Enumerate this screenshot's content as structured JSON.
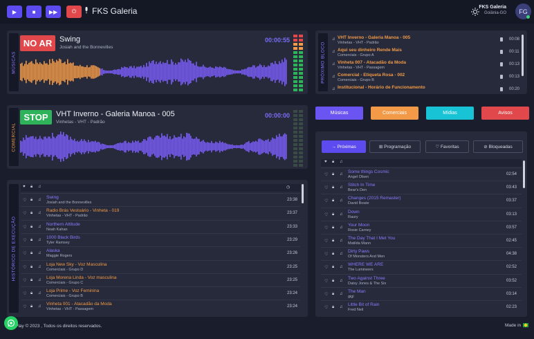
{
  "header": {
    "title": "FKS Galeria",
    "user_name": "FKS Galeria",
    "user_city": "Goiânia-GO",
    "avatar_initials": "FG",
    "buttons": [
      "play-icon",
      "stop-icon",
      "skip-icon",
      "power-icon"
    ]
  },
  "player1": {
    "section_label": "MÚSICAS",
    "badge": "NO AR",
    "badge_color": "#e0484b",
    "title": "Swing",
    "artist": "Josiah and the Bonnevilles",
    "time": "00:00:55",
    "progress": 0.3
  },
  "player2": {
    "section_label": "COMERCIAL",
    "badge": "STOP",
    "badge_color": "#2fb35a",
    "title": "VHT Inverno - Galeria Manoa - 005",
    "artist": "Vinhetas - VHT - Padrão",
    "time": "00:00:00",
    "progress": 0
  },
  "next_block": {
    "section_label": "PRÓXIMO BLOCO",
    "items": [
      {
        "title": "VHT Inverno - Galeria Manoa - 005",
        "sub": "Vinhetas - VHT - Padrão",
        "duration": "00:08"
      },
      {
        "title": "Aqui seu dinheiro Rende Mais",
        "sub": "Comerciais - Grupo A",
        "duration": "00:11"
      },
      {
        "title": "Vinheta 007 - Atacadão da Moda",
        "sub": "Vinhetas - VHT - Passagem",
        "duration": "00:13"
      },
      {
        "title": "Comercial - Etiqueta Rosa - 002",
        "sub": "Comerciais - Grupo B",
        "duration": "00:13"
      },
      {
        "title": "Institucional - Horário de Funcionamento",
        "sub": "",
        "duration": "00:20"
      }
    ]
  },
  "categories": [
    {
      "label": "Músicas",
      "color": "#6b55f2"
    },
    {
      "label": "Comerciais",
      "color": "#f29a47"
    },
    {
      "label": "Mídias",
      "color": "#17c3d4"
    },
    {
      "label": "Avisos",
      "color": "#e0484b"
    }
  ],
  "tabs": [
    {
      "label": "→ Próximas"
    },
    {
      "label": "⊞ Programação"
    },
    {
      "label": "♡ Favoritas"
    },
    {
      "label": "⊘ Bloqueadas"
    }
  ],
  "history": {
    "section_label": "HISTÓRICO DE EXECUÇÃO",
    "rows": [
      {
        "title": "Swing",
        "sub": "Josiah and the Bonnevilles",
        "time": "23:38",
        "orange": false
      },
      {
        "title": "Radio Brás Vestuário - Vinheta - 019",
        "sub": "Vinhetas - VHT - Padrão",
        "time": "23:37",
        "orange": true
      },
      {
        "title": "Northern Attitude",
        "sub": "Noah Kahan",
        "time": "23:33",
        "orange": false
      },
      {
        "title": "1000 Black Birds",
        "sub": "Tyler Ramsey",
        "time": "23:29",
        "orange": false
      },
      {
        "title": "Alaska",
        "sub": "Maggie Rogers",
        "time": "23:26",
        "orange": false
      },
      {
        "title": "Loja New Sky - Voz Masculina",
        "sub": "Comerciais - Grupo D",
        "time": "23:25",
        "orange": true
      },
      {
        "title": "Loja Morena Linda - Voz masculina",
        "sub": "Comerciais - Grupo C",
        "time": "23:25",
        "orange": true
      },
      {
        "title": "Loja Prime - Voz Feminina",
        "sub": "Comerciais - Grupo B",
        "time": "23:24",
        "orange": true
      },
      {
        "title": "Vinheta 001 - Atacadão da Moda",
        "sub": "Vinhetas - VHT - Passagem",
        "time": "23:24",
        "orange": true
      }
    ]
  },
  "next_songs": {
    "rows": [
      {
        "title": "Some things Cosmic",
        "sub": "Angel Olsen",
        "duration": "02:54"
      },
      {
        "title": "Stitch In Time",
        "sub": "Bear's Den",
        "duration": "03:43"
      },
      {
        "title": "Changes (2015 Remaster)",
        "sub": "David Bowie",
        "duration": "03:37"
      },
      {
        "title": "Down",
        "sub": "Raury",
        "duration": "03:13"
      },
      {
        "title": "Your Moon",
        "sub": "Rosie Carney",
        "duration": "03:57"
      },
      {
        "title": "The Day That I Met You",
        "sub": "Matilda Mann",
        "duration": "02:45"
      },
      {
        "title": "Dirty Paws",
        "sub": "Of Monsters And Men",
        "duration": "04:38"
      },
      {
        "title": "WHERE WE ARE",
        "sub": "The Lumineers",
        "duration": "02:52"
      },
      {
        "title": "Two Against Three",
        "sub": "Daisy Jones & The Six",
        "duration": "03:52"
      },
      {
        "title": "The Man",
        "sub": "gigi",
        "duration": "03:14"
      },
      {
        "title": "Little Bit of Rain",
        "sub": "Fred Neil",
        "duration": "02:23"
      }
    ]
  },
  "footer": {
    "copyright": "Play © 2023 , Todos os direitos reservados.",
    "made_in": "Made in"
  }
}
